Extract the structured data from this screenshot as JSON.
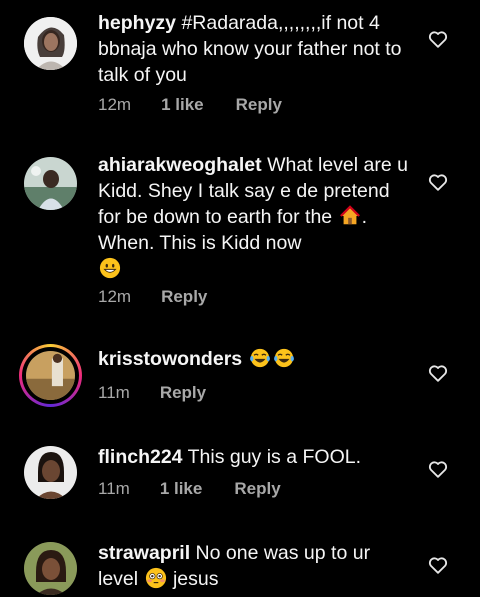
{
  "comments": [
    {
      "username": "hephyzy",
      "text": " #Radarada,,,,,,,,if not 4 bbnaja who know your father not to talk of you",
      "time": "12m",
      "likes": "1 like",
      "reply": "Reply",
      "icon": "heart-outline-icon"
    },
    {
      "username": "ahiarakweoghalet",
      "text_a": " What level are u Kidd. Shey I talk say e de pretend for be down to earth for the ",
      "text_b": ". When. This is Kidd now",
      "time": "12m",
      "reply": "Reply",
      "emojis": [
        "house-emoji",
        "grinning-emoji"
      ],
      "icon": "heart-outline-icon"
    },
    {
      "username": "krisstowonders",
      "text": " ",
      "time": "11m",
      "reply": "Reply",
      "emojis": [
        "tears-of-joy-emoji",
        "tears-of-joy-emoji"
      ],
      "icon": "heart-outline-icon"
    },
    {
      "username": "flinch224",
      "text": " This guy is a FOOL.",
      "time": "11m",
      "likes": "1 like",
      "reply": "Reply",
      "icon": "heart-outline-icon"
    },
    {
      "username": "strawapril",
      "text_a": " No one was up to ur level ",
      "text_b": " jesus",
      "emojis": [
        "flushed-emoji"
      ],
      "icon": "heart-outline-icon"
    }
  ],
  "colors": {
    "background": "#000000",
    "text": "#f5f5f5",
    "meta": "#a8a8a8"
  }
}
